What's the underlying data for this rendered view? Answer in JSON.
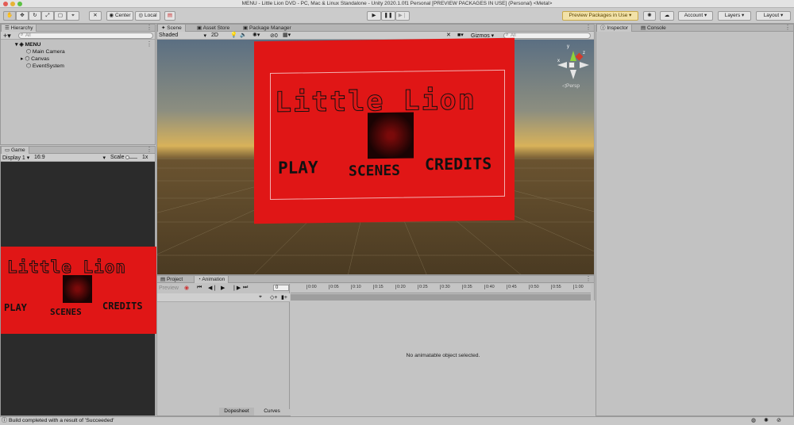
{
  "window": {
    "title": "MENU - Little Lion DVD - PC, Mac & Linux Standalone - Unity 2020.1.0f1 Personal [PREVIEW PACKAGES IN USE] (Personal) <Metal>"
  },
  "toolbar": {
    "pivot_label": "Center",
    "space_label": "Local",
    "preview_packages_label": "Preview Packages in Use",
    "account_label": "Account",
    "layers_label": "Layers",
    "layout_label": "Layout"
  },
  "hierarchy": {
    "tab_label": "Hierarchy",
    "add_label": "+",
    "search_placeholder": "All",
    "scene_name": "MENU",
    "items": [
      "Main Camera",
      "Canvas",
      "EventSystem"
    ]
  },
  "game": {
    "tab_label": "Game",
    "display_label": "Display 1",
    "aspect_label": "16:9",
    "scale_label": "Scale",
    "scale_value": "1x"
  },
  "scene": {
    "tabs": [
      "Scene",
      "Asset Store",
      "Package Manager"
    ],
    "shading_label": "Shaded",
    "mode_2d_label": "2D",
    "hidden_count": "0",
    "gizmos_label": "Gizmos",
    "search_placeholder": "All",
    "persp_label": "Persp",
    "axis_labels": {
      "y": "y",
      "z": "z",
      "x": "x"
    }
  },
  "menu_canvas": {
    "title": "Little Lion",
    "buttons": [
      "PLAY",
      "SCENES",
      "CREDITS"
    ]
  },
  "animation": {
    "tabs": [
      "Project",
      "Animation"
    ],
    "preview_label": "Preview",
    "frame_value": "0",
    "ruler_ticks": [
      "0:00",
      "0:05",
      "0:10",
      "0:15",
      "0:20",
      "0:25",
      "0:30",
      "0:35",
      "0:40",
      "0:45",
      "0:50",
      "0:55",
      "1:00"
    ],
    "empty_message": "No animatable object selected.",
    "bottom_tabs": [
      "Dopesheet",
      "Curves"
    ]
  },
  "inspector": {
    "tabs": [
      "Inspector",
      "Console"
    ]
  },
  "status": {
    "message": "Build completed with a result of 'Succeeded'"
  },
  "colors": {
    "canvas_red": "#e01616",
    "ground": "#4a3a22",
    "sky_top": "#5b6f82",
    "sky_horizon": "#d8b25a"
  }
}
